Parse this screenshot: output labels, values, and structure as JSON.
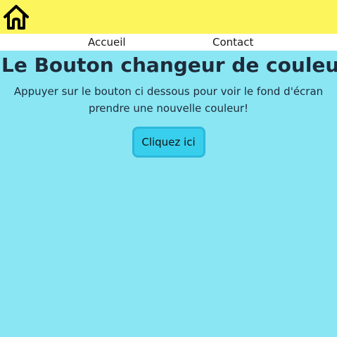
{
  "topbar": {
    "home_icon": "home-icon",
    "background": "#fdf55c"
  },
  "nav": {
    "items": [
      {
        "label": "Accueil"
      },
      {
        "label": "Contact"
      }
    ]
  },
  "main": {
    "title": "Le Bouton changeur de couleur",
    "description": "Appuyer sur le bouton ci dessous pour voir le fond d'écran prendre une nouvelle couleur!",
    "button_label": "Cliquez ici",
    "background": "#8ae6f3",
    "button_color": "#38cfec"
  }
}
